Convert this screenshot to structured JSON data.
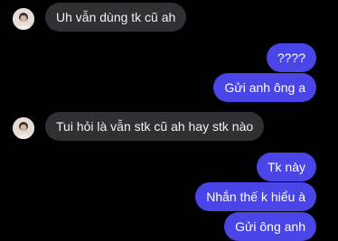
{
  "conversation": {
    "messages": [
      {
        "direction": "incoming",
        "text": "Uh vẫn dùng tk cũ ah",
        "show_avatar": true
      },
      {
        "direction": "outgoing",
        "text": "????"
      },
      {
        "direction": "outgoing",
        "text": "Gửi anh ông a"
      },
      {
        "direction": "incoming",
        "text": "Tui hỏi là vẫn stk cũ ah hay stk nào",
        "show_avatar": true
      },
      {
        "direction": "outgoing",
        "text": "Tk này"
      },
      {
        "direction": "outgoing",
        "text": "Nhắn thế k hiểu à"
      },
      {
        "direction": "outgoing",
        "text": "Gửi ông anh"
      }
    ]
  },
  "colors": {
    "background": "#000000",
    "incoming_bubble": "#303033",
    "outgoing_bubble": "#4a45e6",
    "text": "#ffffff"
  },
  "icons": {
    "avatar": "contact-avatar-icon"
  }
}
